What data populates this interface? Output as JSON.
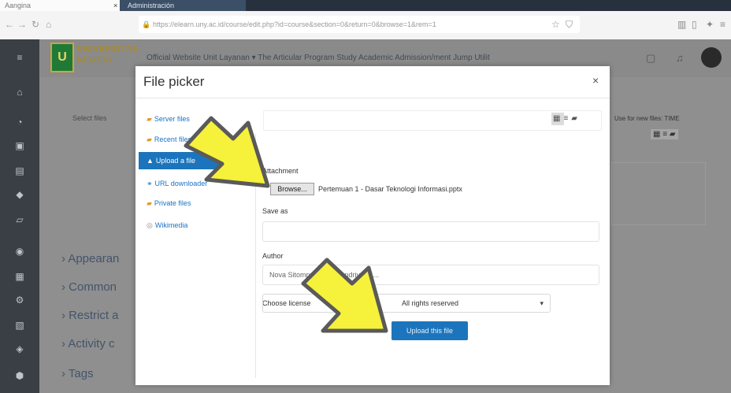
{
  "browser": {
    "tab1_title": "Aangina",
    "tab2_title": "Administración",
    "url": "https://elearn.uny.ac.id/course/edit.php?id=course&section=0&return=0&browse=1&rem=1",
    "close_tab": "×"
  },
  "page": {
    "logo_letter": "U",
    "logo_text": [
      "UNIVERSITAS",
      "NEGERI"
    ],
    "header_nav": "Official Website   Unit Layanan ▾   The Articular Program Study   Academic   Admission/ment   Jump Utilit",
    "select_files_label": "Select files",
    "right_hint": "Use for new files: TIME",
    "sections": [
      "› Appearan",
      "› Common",
      "› Restrict a",
      "› Activity c",
      "› Tags"
    ]
  },
  "dialog": {
    "title": "File picker",
    "close": "×",
    "repositories": [
      {
        "label": "Server files",
        "icon": "folder-icon"
      },
      {
        "label": "Recent files",
        "icon": "clock-icon"
      },
      {
        "label": "Upload a file",
        "icon": "upload-icon",
        "active": true
      },
      {
        "label": "URL downloader",
        "icon": "link-icon"
      },
      {
        "label": "Private files",
        "icon": "folder-icon"
      },
      {
        "label": "Wikimedia",
        "icon": "globe-icon"
      }
    ],
    "attachment_label": "Attachment",
    "browse_label": "Browse...",
    "chosen_file": "Pertemuan 1 - Dasar Teknologi Informasi.pptx",
    "saveas_label": "Save as",
    "saveas_value": "",
    "author_label": "Author",
    "author_value": "Nova Sitompul dan R. Andriyaldi ...",
    "license_label": "Choose license",
    "license_value": "All rights reserved",
    "upload_button": "Upload this file"
  },
  "colors": {
    "accent": "#1c75bc",
    "arrow_fill": "#f6f13a",
    "arrow_stroke": "#5a5a5a"
  }
}
